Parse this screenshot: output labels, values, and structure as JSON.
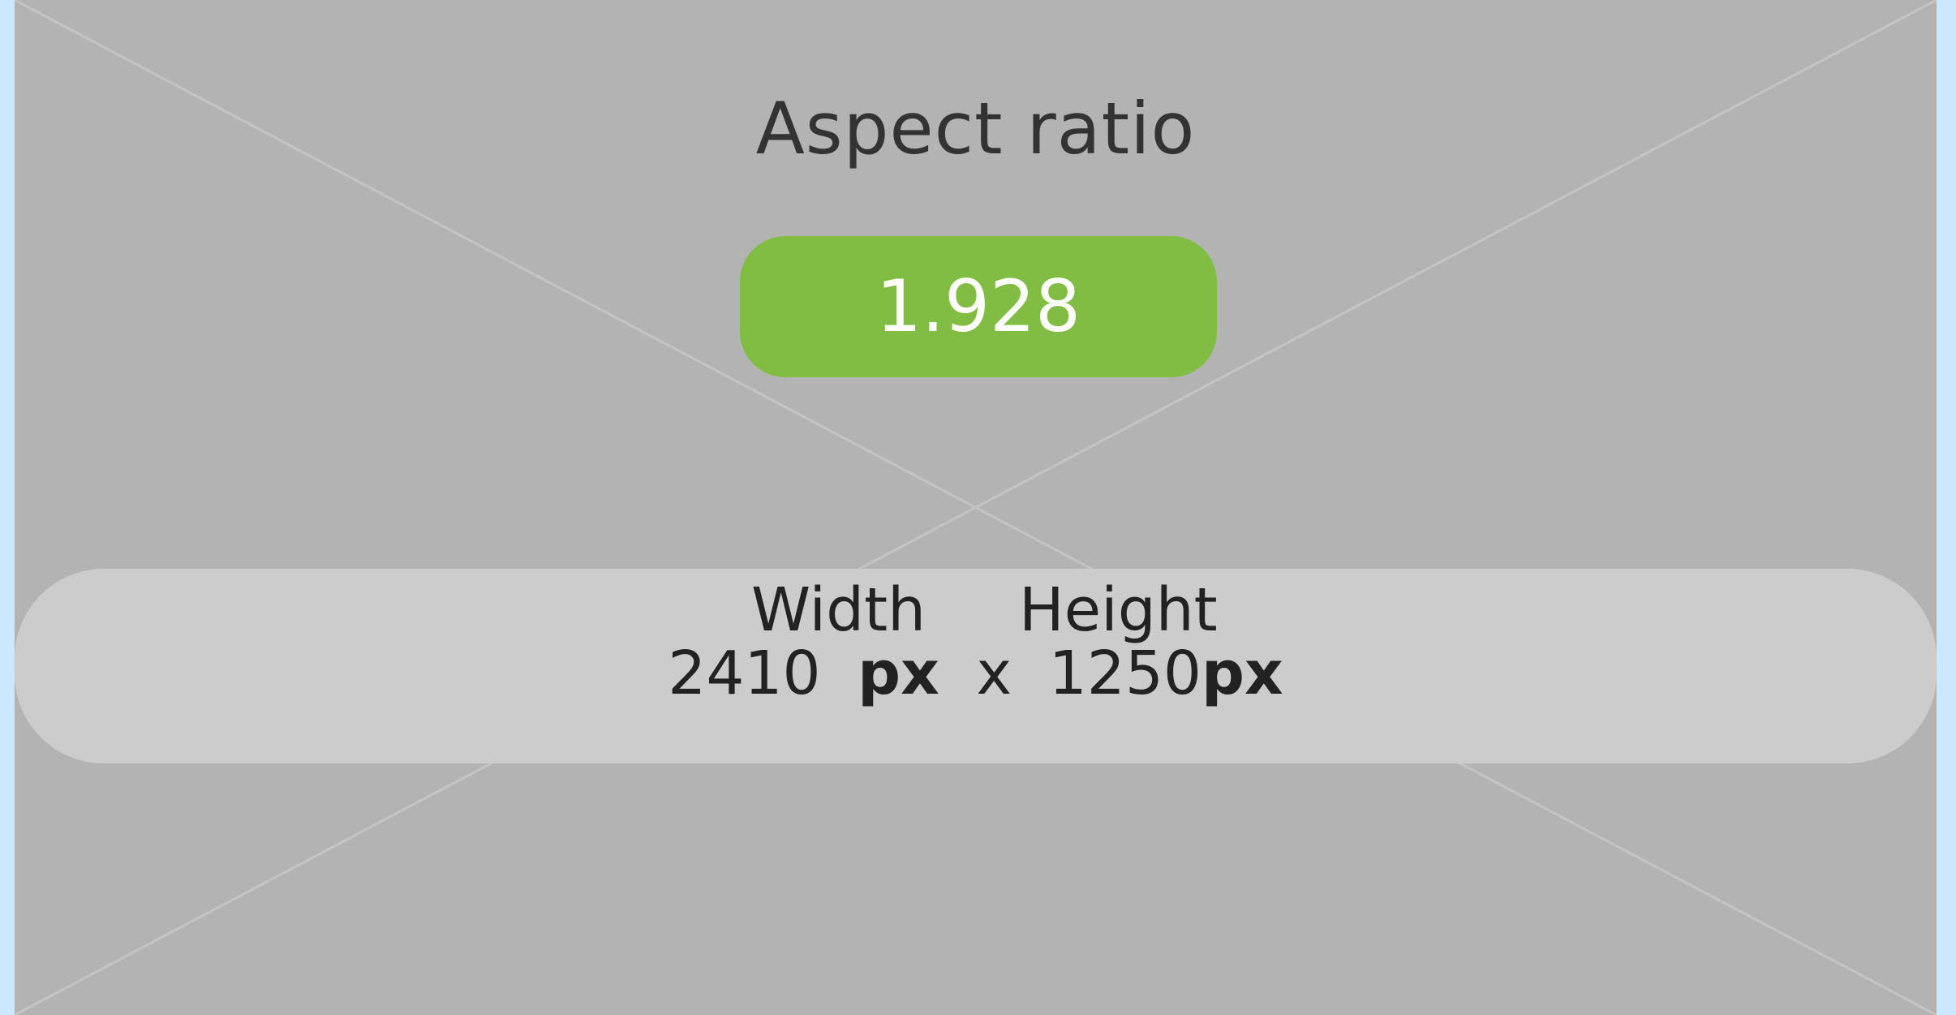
{
  "title": "Aspect ratio",
  "ratio": "1.928",
  "dimensions": {
    "width_label": "Width",
    "height_label": "Height",
    "width_value": "2410",
    "width_unit": "px",
    "separator": "x",
    "height_value": "1250",
    "height_unit": "px"
  },
  "colors": {
    "page_border": "#cce8ff",
    "background": "#b3b3b3",
    "ratio_pill": "#82bd43",
    "dims_bar": "#cccccc"
  }
}
